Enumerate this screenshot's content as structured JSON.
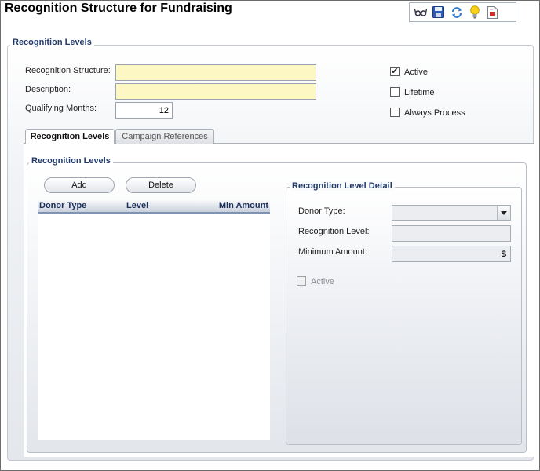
{
  "window": {
    "title": "Recognition Structure for Fundraising"
  },
  "toolbar": {
    "icons": [
      "glasses-icon",
      "save-icon",
      "refresh-icon",
      "lightbulb-icon",
      "report-icon"
    ]
  },
  "main_section": {
    "legend": "Recognition Levels",
    "recognition_structure_label": "Recognition Structure:",
    "recognition_structure_value": "",
    "description_label": "Description:",
    "description_value": "",
    "qualifying_months_label": "Qualifying Months:",
    "qualifying_months_value": "12",
    "active_label": "Active",
    "active_checked": true,
    "lifetime_label": "Lifetime",
    "lifetime_checked": false,
    "always_process_label": "Always Process",
    "always_process_checked": false
  },
  "tabs": [
    {
      "label": "Recognition Levels",
      "active": true
    },
    {
      "label": "Campaign References",
      "active": false
    }
  ],
  "levels_panel": {
    "legend": "Recognition Levels",
    "add_label": "Add",
    "delete_label": "Delete",
    "columns": [
      "Donor Type",
      "Level",
      "Min Amount"
    ],
    "rows": []
  },
  "detail_panel": {
    "legend": "Recognition Level Detail",
    "donor_type_label": "Donor Type:",
    "donor_type_value": "",
    "recognition_level_label": "Recognition Level:",
    "recognition_level_value": "",
    "minimum_amount_label": "Minimum Amount:",
    "minimum_amount_value": "$",
    "active_label": "Active",
    "active_checked": false
  }
}
